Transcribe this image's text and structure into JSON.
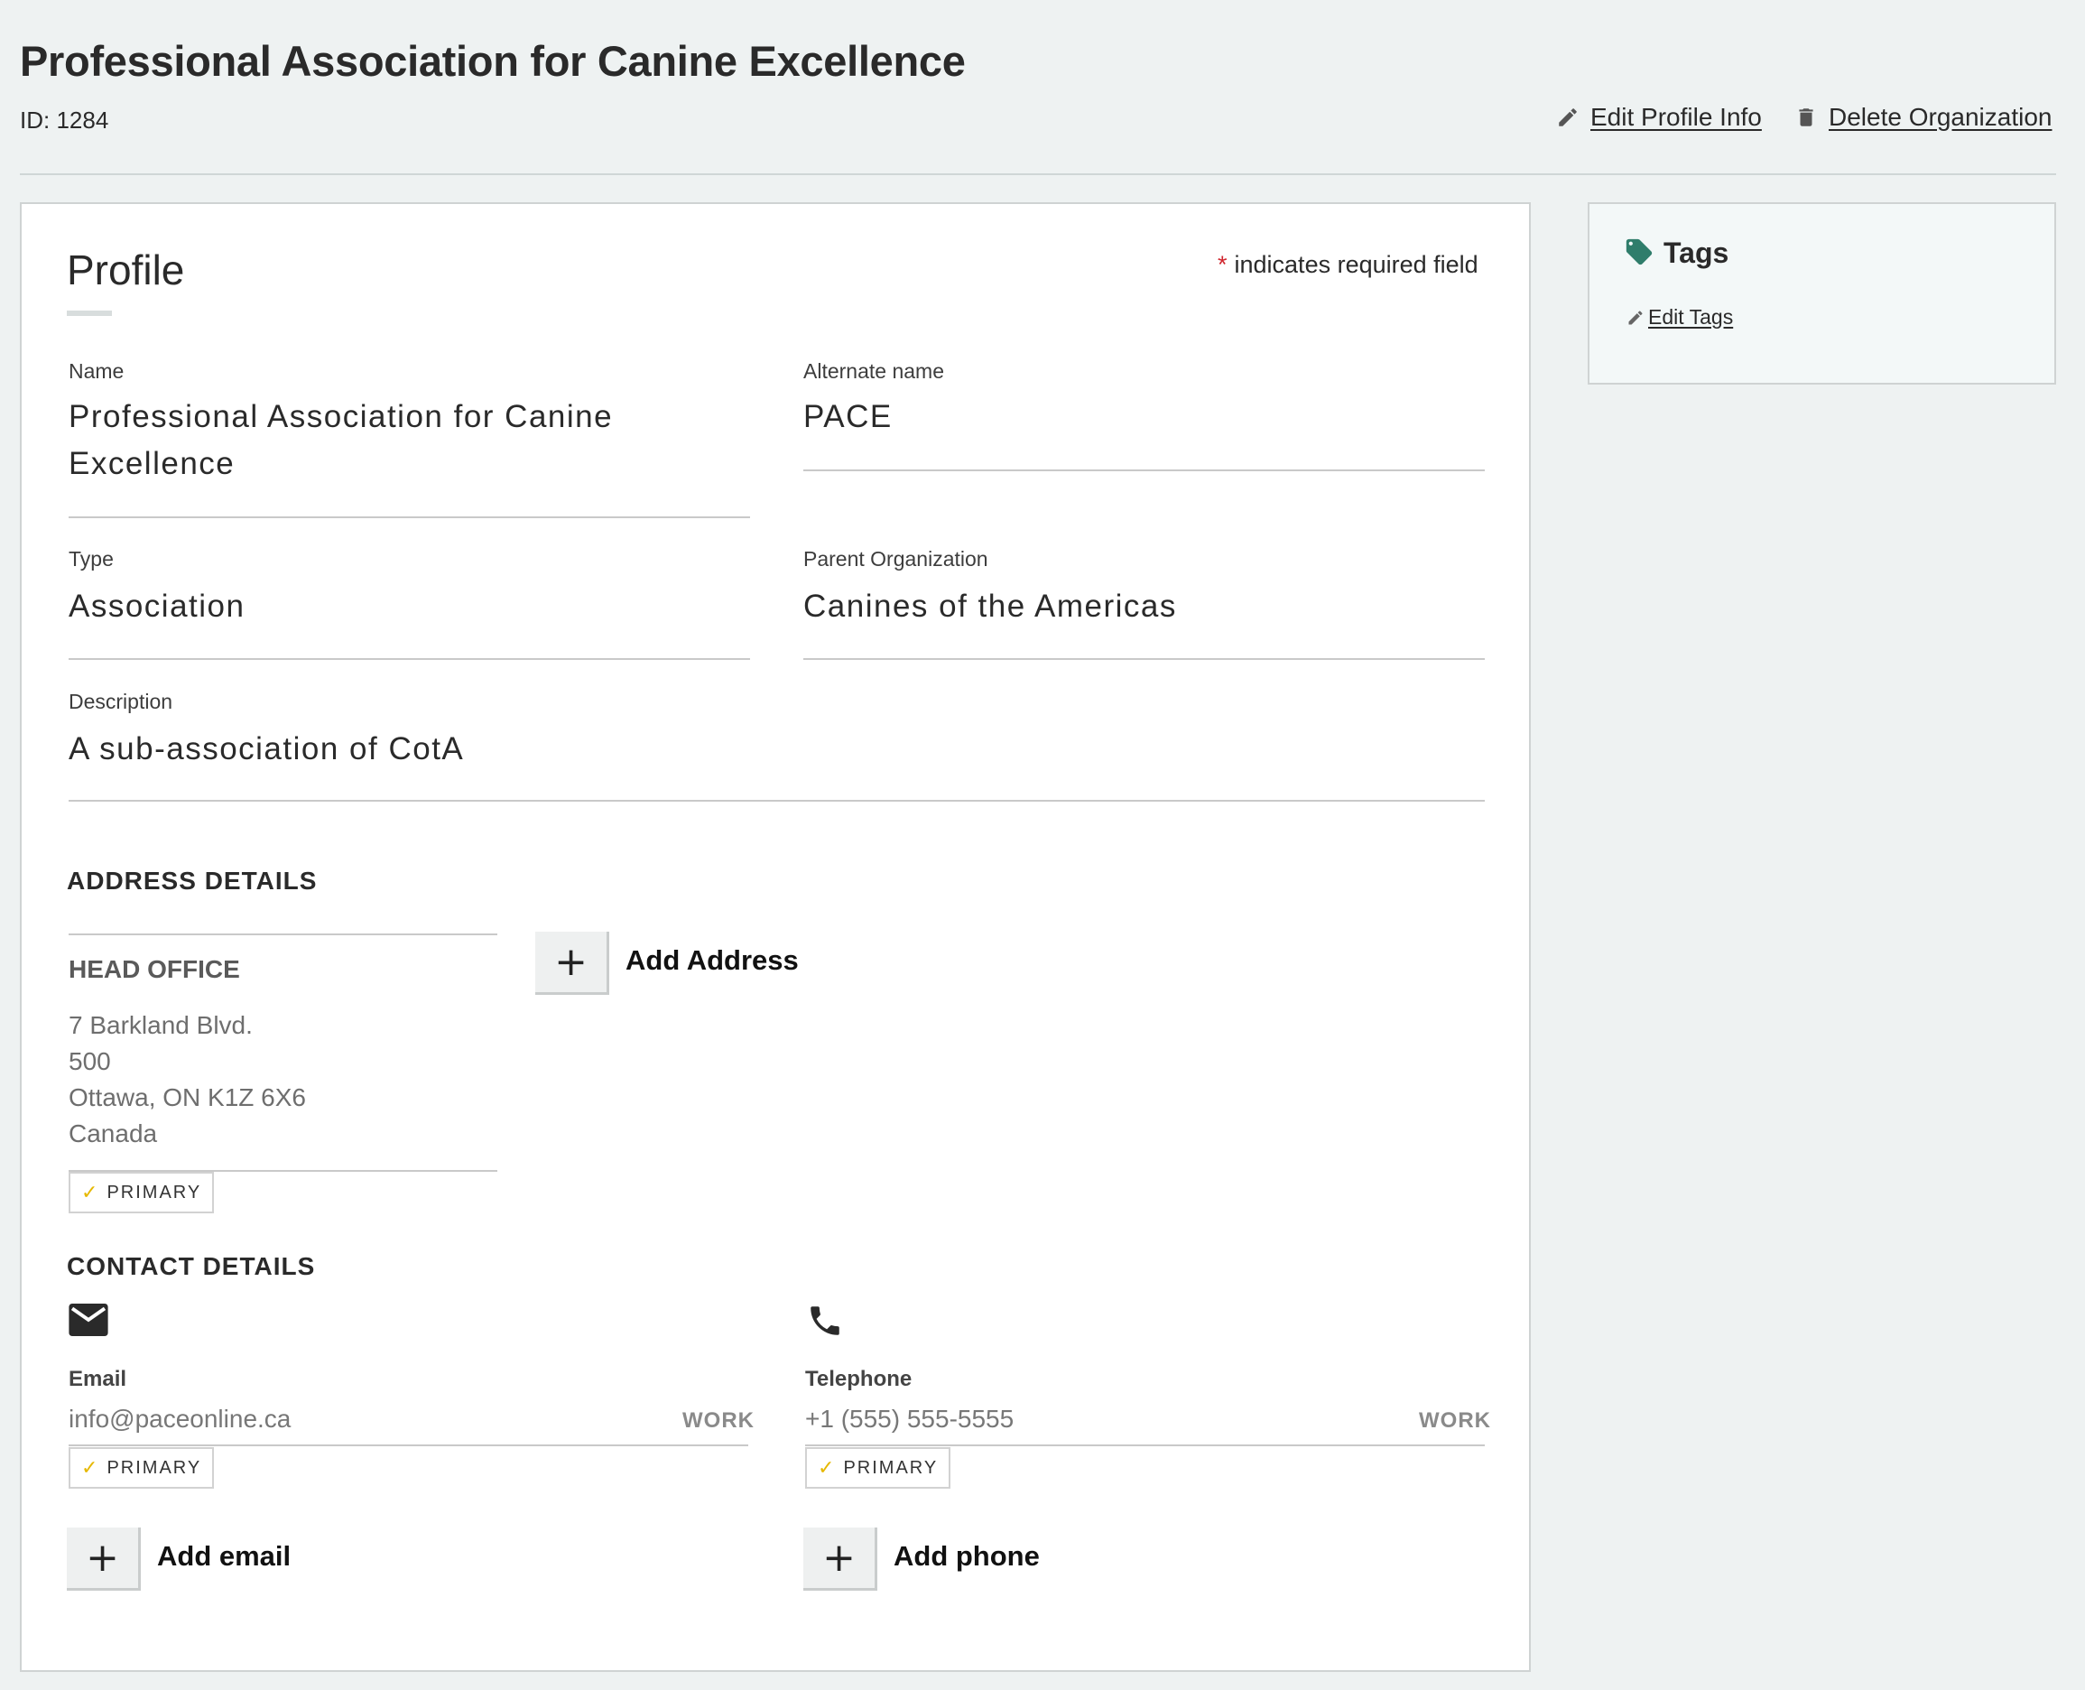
{
  "header": {
    "title": "Professional Association for Canine Excellence",
    "id_label": "ID: 1284",
    "edit_profile_label": "Edit Profile Info",
    "delete_org_label": "Delete Organization"
  },
  "profile": {
    "section_title": "Profile",
    "required_star": "*",
    "required_note": "indicates required field",
    "fields": {
      "name": {
        "label": "Name",
        "value_line1": "Professional Association for Canine",
        "value_line2": "Excellence"
      },
      "alternate_name": {
        "label": "Alternate name",
        "value": "PACE"
      },
      "type": {
        "label": "Type",
        "value": "Association"
      },
      "parent_org": {
        "label": "Parent Organization",
        "value": "Canines of the Americas"
      },
      "description": {
        "label": "Description",
        "value": "A sub-association of CotA"
      }
    }
  },
  "address": {
    "heading": "ADDRESS DETAILS",
    "card": {
      "name": "HEAD OFFICE",
      "line1": "7 Barkland Blvd.",
      "line2": "500",
      "line3": "Ottawa, ON K1Z 6X6",
      "line4": "Canada",
      "badge": "PRIMARY"
    },
    "add_button": "+",
    "add_label": "Add Address"
  },
  "contact": {
    "heading": "CONTACT DETAILS",
    "email": {
      "label": "Email",
      "value": "info@paceonline.ca",
      "kind": "WORK",
      "badge": "PRIMARY",
      "add_button": "+",
      "add_label": "Add email"
    },
    "phone": {
      "label": "Telephone",
      "value": "+1 (555) 555-5555",
      "kind": "WORK",
      "badge": "PRIMARY",
      "add_button": "+",
      "add_label": "Add phone"
    }
  },
  "tags": {
    "title": "Tags",
    "edit_label": "Edit Tags"
  },
  "theme": {
    "background": "#eef2f2",
    "tag_icon_color": "#2f7d6b",
    "required_color": "#d0262e",
    "check_color": "#e6b800"
  },
  "icons": {
    "edit": "pencil-icon",
    "delete": "trash-icon",
    "tag": "tag-icon",
    "email": "envelope-icon",
    "phone": "phone-icon",
    "check": "check-icon"
  }
}
